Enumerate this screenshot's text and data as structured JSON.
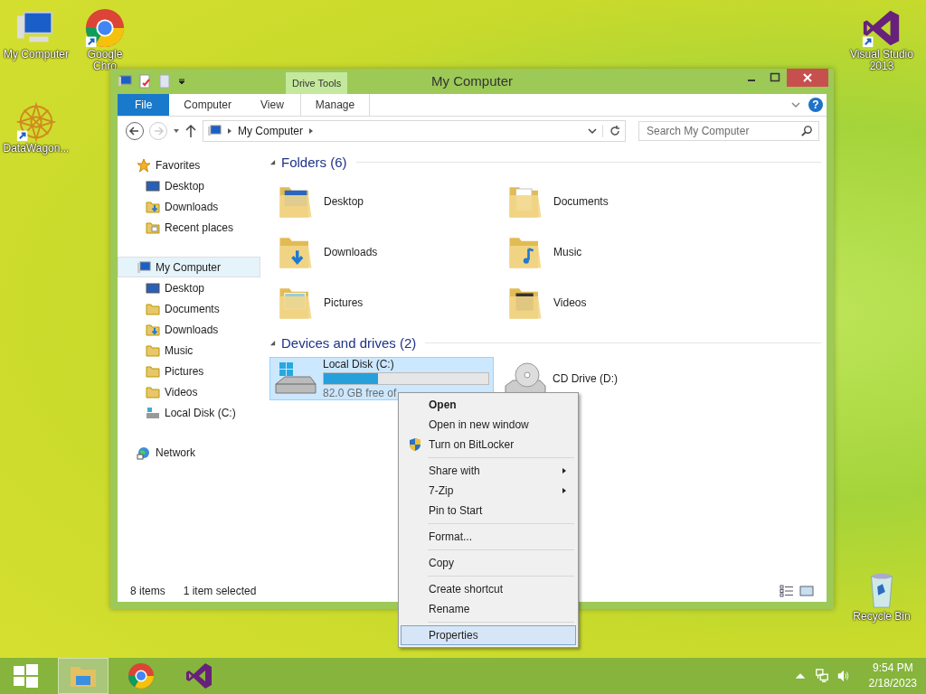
{
  "desktop_icons": [
    {
      "kind": "computer",
      "label_lines": [
        "My Computer"
      ],
      "shortcut": false
    },
    {
      "kind": "chrome",
      "label_lines": [
        "Google",
        "Chro"
      ],
      "shortcut": true
    },
    {
      "kind": "datawagon",
      "label_lines": [
        "DataWagon..."
      ],
      "shortcut": true
    },
    {
      "kind": "vs",
      "label_lines": [
        "Visual Studio",
        "2013"
      ],
      "shortcut": true
    },
    {
      "kind": "recycle",
      "label_lines": [
        "Recycle Bin"
      ],
      "shortcut": false
    }
  ],
  "window": {
    "title": "My Computer",
    "contextual_tab": "Drive Tools",
    "ribbon_tabs": [
      {
        "label": "File",
        "kind": "file",
        "selected": false
      },
      {
        "label": "Computer",
        "kind": "tab",
        "selected": false
      },
      {
        "label": "View",
        "kind": "tab",
        "selected": false
      },
      {
        "label": "Manage",
        "kind": "contextual",
        "selected": false
      }
    ],
    "help_button": "?",
    "address": {
      "crumbs": [
        "My Computer"
      ]
    },
    "search": {
      "placeholder": "Search My Computer"
    },
    "navigation": [
      {
        "label": "Favorites",
        "kind": "star",
        "selected": false,
        "children": [
          {
            "label": "Desktop",
            "kind": "desktop",
            "selected": false
          },
          {
            "label": "Downloads",
            "kind": "downloads",
            "selected": false
          },
          {
            "label": "Recent places",
            "kind": "places",
            "selected": false
          }
        ]
      },
      {
        "label": "My Computer",
        "kind": "computer",
        "selected": true,
        "children": [
          {
            "label": "Desktop",
            "kind": "desktop",
            "selected": false
          },
          {
            "label": "Documents",
            "kind": "folder",
            "selected": false
          },
          {
            "label": "Downloads",
            "kind": "downloads",
            "selected": false
          },
          {
            "label": "Music",
            "kind": "folder",
            "selected": false
          },
          {
            "label": "Pictures",
            "kind": "folder",
            "selected": false
          },
          {
            "label": "Videos",
            "kind": "folder",
            "selected": false
          },
          {
            "label": "Local Disk (C:)",
            "kind": "disk",
            "selected": false
          }
        ]
      },
      {
        "label": "Network",
        "kind": "network",
        "selected": false
      }
    ],
    "folders": {
      "heading": "Folders (6)",
      "items": [
        {
          "label": "Desktop",
          "kind": "desktop"
        },
        {
          "label": "Documents",
          "kind": "documents"
        },
        {
          "label": "Downloads",
          "kind": "downloads"
        },
        {
          "label": "Music",
          "kind": "music"
        },
        {
          "label": "Pictures",
          "kind": "pictures"
        },
        {
          "label": "Videos",
          "kind": "videos"
        }
      ]
    },
    "drives": {
      "heading": "Devices and drives (2)",
      "items": [
        {
          "label": "Local Disk (C:)",
          "kind": "disk",
          "selected": true,
          "level": 0.33,
          "free_space": "82.0 GB free of"
        },
        {
          "label": "CD Drive (D:)",
          "kind": "cd",
          "selected": false
        }
      ]
    },
    "status_bar": {
      "count": "8 items",
      "selection": "1 item selected"
    }
  },
  "context_menu": [
    [
      {
        "label": "Open",
        "kind": "default",
        "selected": false
      },
      {
        "label": "Open in new window",
        "kind": "normal",
        "selected": false
      },
      {
        "label": "Turn on BitLocker",
        "kind": "shield",
        "selected": false
      }
    ],
    [
      {
        "label": "Share with",
        "kind": "submenu",
        "selected": false
      },
      {
        "label": "7-Zip",
        "kind": "submenu",
        "selected": false
      },
      {
        "label": "Pin to Start",
        "kind": "normal",
        "selected": false
      }
    ],
    [
      {
        "label": "Format...",
        "kind": "normal",
        "selected": false
      }
    ],
    [
      {
        "label": "Copy",
        "kind": "normal",
        "selected": false
      }
    ],
    [
      {
        "label": "Create shortcut",
        "kind": "normal",
        "selected": false
      },
      {
        "label": "Rename",
        "kind": "normal",
        "selected": false
      }
    ],
    [
      {
        "label": "Properties",
        "kind": "normal",
        "selected": true
      }
    ]
  ],
  "taskbar": {
    "buttons": [
      {
        "kind": "start",
        "selected": false
      },
      {
        "kind": "explorer",
        "selected": true
      },
      {
        "kind": "chrome",
        "selected": false
      },
      {
        "kind": "vs",
        "selected": false
      }
    ],
    "time": "9:54 PM",
    "date": "2/18/2023"
  }
}
